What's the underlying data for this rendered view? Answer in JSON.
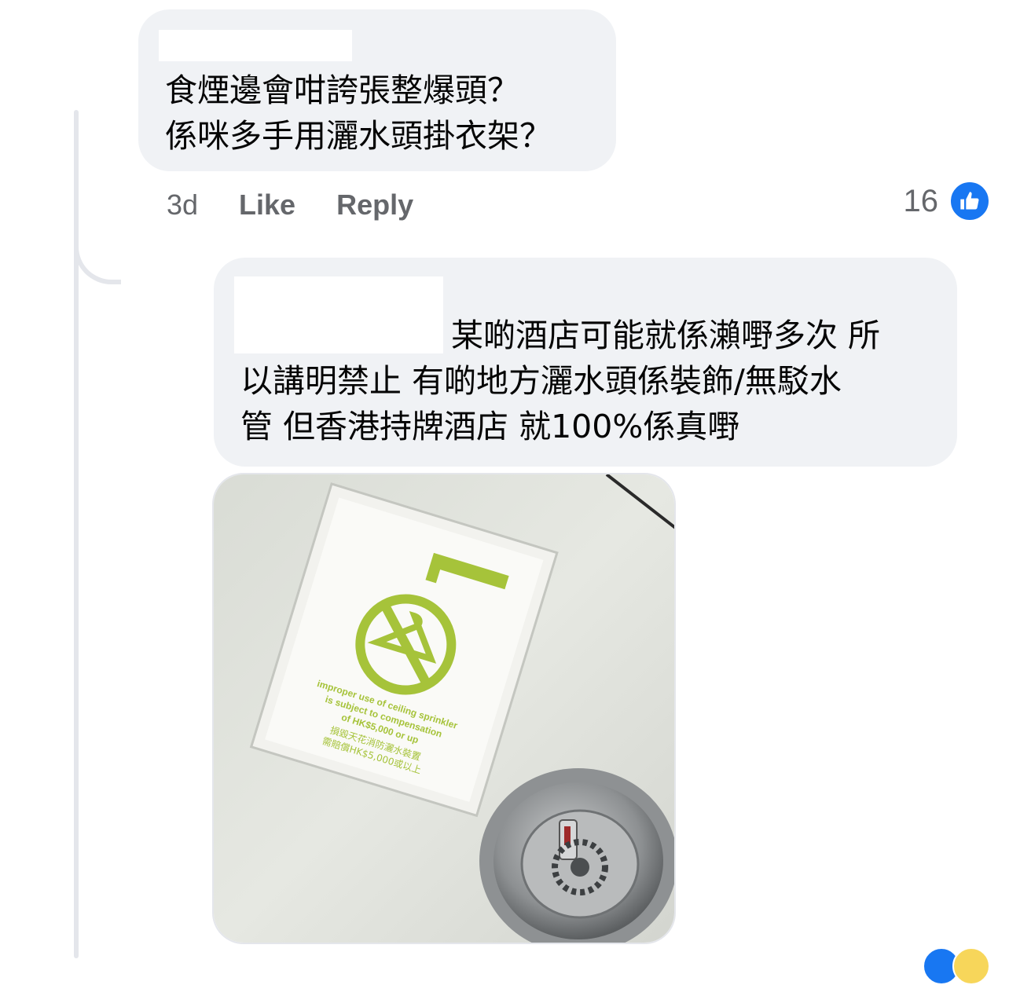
{
  "comment1": {
    "lines": [
      "食煙邊會咁誇張整爆頭？",
      "係咪多手用灑水頭掛衣架？"
    ],
    "time": "3d",
    "like_label": "Like",
    "reply_label": "Reply",
    "reaction_count": "16",
    "reaction_icon": "like-thumb-icon"
  },
  "comment2": {
    "lines": [
      "某啲酒店可能就係瀨嘢多次 所",
      "以講明禁止 有啲地方灑水頭係裝飾/無駁水",
      "管 但香港持牌酒店 就100%係真嘢"
    ],
    "photo": {
      "sign_lines_en": [
        "improper use of ceiling sprinkler",
        "is subject to compensation",
        "of HK$5,000 or up"
      ],
      "sign_lines_zh": [
        "損毀天花消防灑水裝置",
        "需賠償HK$5,000或以上"
      ]
    }
  },
  "colors": {
    "bubble": "#f0f2f5",
    "meta_text": "#65676b",
    "like_blue": "#1877f2",
    "sign_green": "#a6c33a"
  }
}
